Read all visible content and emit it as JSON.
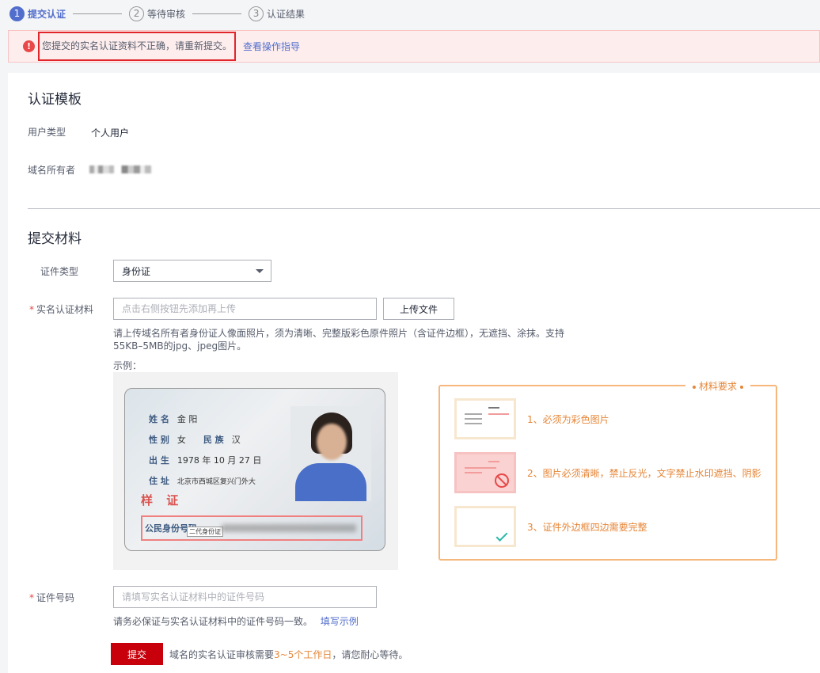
{
  "steps": [
    {
      "num": "1",
      "label": "提交认证",
      "active": true
    },
    {
      "num": "2",
      "label": "等待审核",
      "active": false
    },
    {
      "num": "3",
      "label": "认证结果",
      "active": false
    }
  ],
  "alert": {
    "icon": "!",
    "message": "您提交的实名认证资料不正确，请重新提交。",
    "link": "查看操作指导"
  },
  "template": {
    "title": "认证模板",
    "user_type_label": "用户类型",
    "user_type_value": "个人用户",
    "owner_label": "域名所有者"
  },
  "materials": {
    "title": "提交材料",
    "cert_type_label": "证件类型",
    "cert_type_value": "身份证",
    "material_label": "实名认证材料",
    "material_placeholder": "点击右侧按钮先添加再上传",
    "upload_button": "上传文件",
    "material_hint_1": "请上传域名所有者身份证人像面照片，须为清晰、完整版彩色原件照片（含证件边框），无遮挡、涂抹。支持",
    "material_hint_2": "55KB–5MB的jpg、jpeg图片。",
    "example_label": "示例：",
    "cert_no_label": "证件号码",
    "cert_no_placeholder": "请填写实名认证材料中的证件号码",
    "cert_no_hint": "请务必保证与实名认证材料中的证件号码一致。",
    "cert_no_link": "填写示例"
  },
  "idcard": {
    "name_label": "姓 名",
    "name_value": "金 阳",
    "gender_label": "性 别",
    "gender_value": "女",
    "ethnicity_label": "民 族",
    "ethnicity_value": "汉",
    "birth_label": "出 生",
    "birth_value": "1978 年 10 月 27 日",
    "address_label": "住 址",
    "address_value": "北京市西城区复兴门外大",
    "stamp": "样 证",
    "id_label": "公民身份号码",
    "id_tag": "二代身份证"
  },
  "requirements": {
    "title": "材料要求",
    "items": [
      "1、必须为彩色图片",
      "2、图片必须清晰，禁止反光，文字禁止水印遮挡、阴影",
      "3、证件外边框四边需要完整"
    ]
  },
  "submit": {
    "button": "提交",
    "hint_prefix": "域名的实名认证审核需要",
    "hint_highlight": "3~5个工作日",
    "hint_suffix": "，请您耐心等待。"
  },
  "colors": {
    "primary": "#526ecc",
    "danger": "#c7000b",
    "warning": "#e68638",
    "alert_bg": "#fdeded"
  }
}
